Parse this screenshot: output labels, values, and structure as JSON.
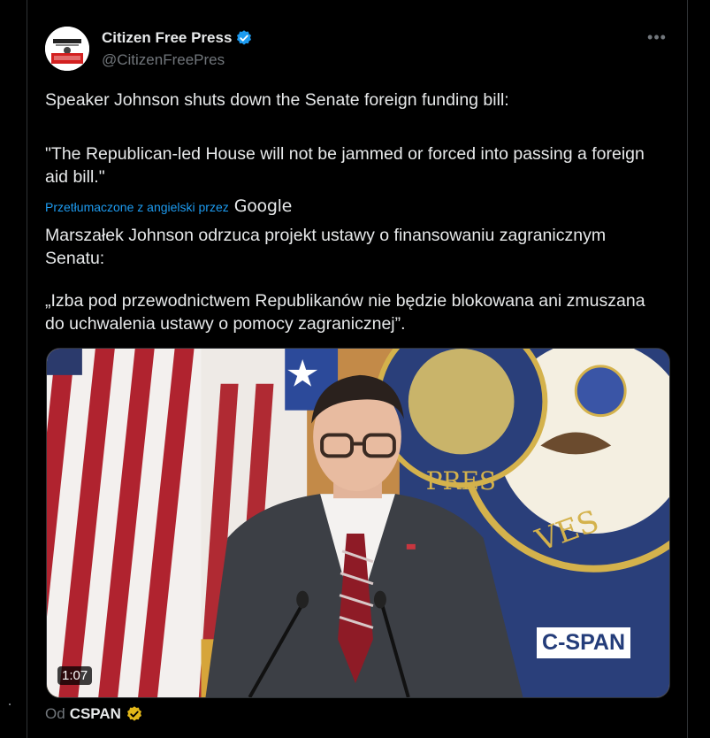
{
  "account": {
    "display_name": "Citizen Free Press",
    "handle": "@CitizenFreePres",
    "verified_icon": "verified-badge-icon",
    "avatar_icon": "citizen-free-press-logo"
  },
  "menu": {
    "more_label": "•••"
  },
  "tweet": {
    "original_line1": "Speaker Johnson shuts down the Senate foreign funding bill:",
    "original_line2": "\"The Republican-led House will not be jammed or forced into passing a foreign aid bill.\"",
    "translated_label": "Przetłumaczone z angielski przez",
    "translator_brand": "Google",
    "translated_line1": "Marszałek Johnson odrzuca projekt ustawy o finansowaniu zagranicznym Senatu:",
    "translated_line2": "„Izba pod przewodnictwem Republikanów nie będzie blokowana ani zmuszana do uchwalenia ustawy o pomocy zagranicznej”."
  },
  "video": {
    "duration": "1:07",
    "watermark": "C-SPAN",
    "colors": {
      "wall": "#c48c4a",
      "seal_blue": "#2a3f7a",
      "seal_gold": "#d4b24c"
    }
  },
  "source": {
    "prefix": "Od",
    "name": "CSPAN",
    "badge_icon": "gold-verified-badge-icon"
  },
  "colors": {
    "accent": "#1d9bf0",
    "secondary_text": "#71767b",
    "gold_badge": "#e2b719"
  }
}
